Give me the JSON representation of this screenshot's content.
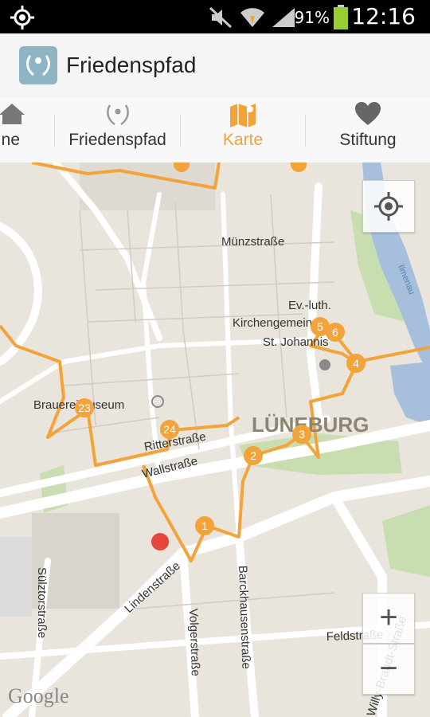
{
  "status_bar": {
    "battery_pct": "91%",
    "time": "12:16"
  },
  "action_bar": {
    "title": "Friedenspfad"
  },
  "tabs": [
    {
      "label": "ne",
      "icon": "home-icon"
    },
    {
      "label": "Friedenspfad",
      "icon": "dove-icon"
    },
    {
      "label": "Karte",
      "icon": "map-icon",
      "active": true
    },
    {
      "label": "Stiftung",
      "icon": "heart-icon"
    }
  ],
  "map": {
    "labels": {
      "muenzstrasse": "Münzstraße",
      "church1": "Ev.-luth.",
      "church2": "Kirchengemeinde",
      "church3": "St. Johannis",
      "museum": "Brauereimuseum",
      "ritterstrasse": "Ritterstraße",
      "wallstrasse": "Wallstraße",
      "city": "LÜNEBURG",
      "sulztorstrasse": "Sülztorstraße",
      "lindenstrasse": "Lindenstraße",
      "volgerstrasse": "Volgerstraße",
      "barckhausenstrasse": "Barckhausenstraße",
      "feldstrasse": "Feldstraße",
      "willybrandt": "Willy-Brandt-Straße",
      "ilmenau": "Ilmenau",
      "google": "Google"
    },
    "markers": [
      "1",
      "2",
      "3",
      "4",
      "5",
      "6",
      "23",
      "24"
    ],
    "zoom_in": "+",
    "zoom_out": "−",
    "colors": {
      "route": "#f2a33a",
      "marker": "#f2a33a",
      "location": "#e5453a"
    }
  }
}
